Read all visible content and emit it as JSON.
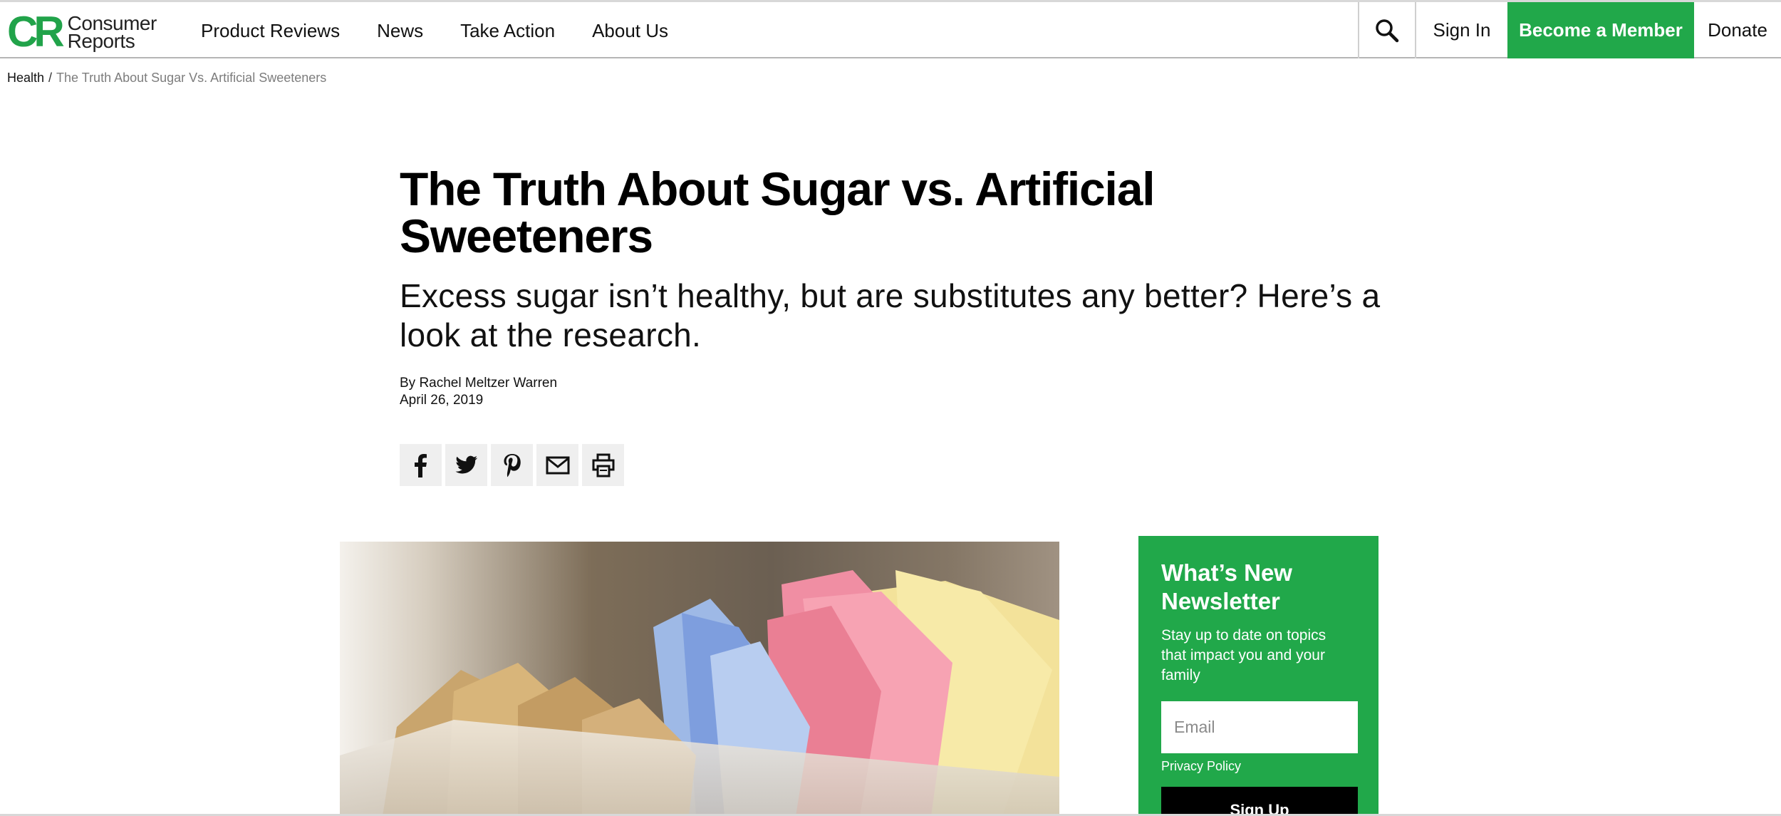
{
  "header": {
    "logo_mark": "CR",
    "logo_line1": "Consumer",
    "logo_line2": "Reports",
    "nav": [
      "Product Reviews",
      "News",
      "Take Action",
      "About Us"
    ],
    "search_icon": "search-icon",
    "sign_in": "Sign In",
    "become_member": "Become a Member",
    "donate": "Donate",
    "accent_color": "#21a84a"
  },
  "breadcrumb": {
    "home": "Health",
    "separator": "/",
    "current": "The Truth About Sugar Vs. Artificial Sweeteners"
  },
  "article": {
    "title": "The Truth About Sugar vs. Artificial Sweeteners",
    "subtitle": "Excess sugar isn’t healthy, but are substitutes any better? Here’s a look at the research.",
    "author": "By Rachel Meltzer Warren",
    "date": "April 26, 2019",
    "share_icons": [
      "facebook-icon",
      "twitter-icon",
      "pinterest-icon",
      "email-icon",
      "print-icon"
    ]
  },
  "hero_image": {
    "description_icon": "sweetener-packets-image"
  },
  "newsletter": {
    "title": "What’s New Newsletter",
    "text": "Stay up to date on topics that impact you and your family",
    "email_placeholder": "Email",
    "privacy": "Privacy Policy",
    "button": "Sign Up"
  }
}
